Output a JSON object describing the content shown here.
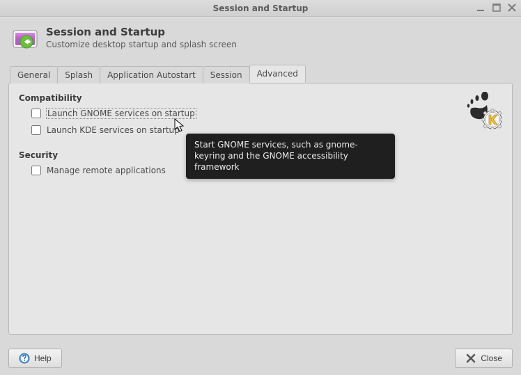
{
  "window": {
    "title": "Session and Startup"
  },
  "header": {
    "title": "Session and Startup",
    "subtitle": "Customize desktop startup and splash screen"
  },
  "tabs": [
    {
      "label": "General"
    },
    {
      "label": "Splash"
    },
    {
      "label": "Application Autostart"
    },
    {
      "label": "Session"
    },
    {
      "label": "Advanced"
    }
  ],
  "sections": {
    "compatibility": {
      "title": "Compatibility",
      "gnome_label": "Launch GNOME services on startup",
      "kde_label": "Launch KDE services on startup"
    },
    "security": {
      "title": "Security",
      "remote_label": "Manage remote applications"
    }
  },
  "tooltip": {
    "text": "Start GNOME services, such as gnome-keyring and the GNOME accessibility framework"
  },
  "buttons": {
    "help": "Help",
    "close": "Close"
  }
}
